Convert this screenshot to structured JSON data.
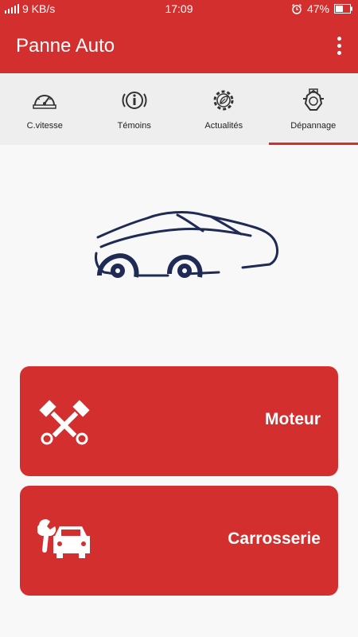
{
  "status_bar": {
    "network_speed": "9 KB/s",
    "time": "17:09",
    "battery": "47%",
    "signal_icon": "signal-icon",
    "alarm_icon": "alarm-icon",
    "battery_icon": "battery-icon"
  },
  "app_bar": {
    "title": "Panne Auto",
    "menu_icon": "overflow-menu-icon"
  },
  "tabs": [
    {
      "label": "C.vitesse",
      "icon": "speedometer-icon",
      "active": false
    },
    {
      "label": "Témoins",
      "icon": "warning-light-icon",
      "active": false
    },
    {
      "label": "Actualités",
      "icon": "gear-leaf-icon",
      "active": false
    },
    {
      "label": "Dépannage",
      "icon": "engine-icon",
      "active": true
    }
  ],
  "hero": {
    "icon": "car-silhouette-icon"
  },
  "cards": [
    {
      "label": "Moteur",
      "icon": "pistons-icon"
    },
    {
      "label": "Carrosserie",
      "icon": "car-wrench-icon"
    }
  ],
  "colors": {
    "primary": "#d32f2f",
    "tab_background": "#eeeeee",
    "page_background": "#f8f8f8",
    "car_outline": "#1f2a55"
  }
}
